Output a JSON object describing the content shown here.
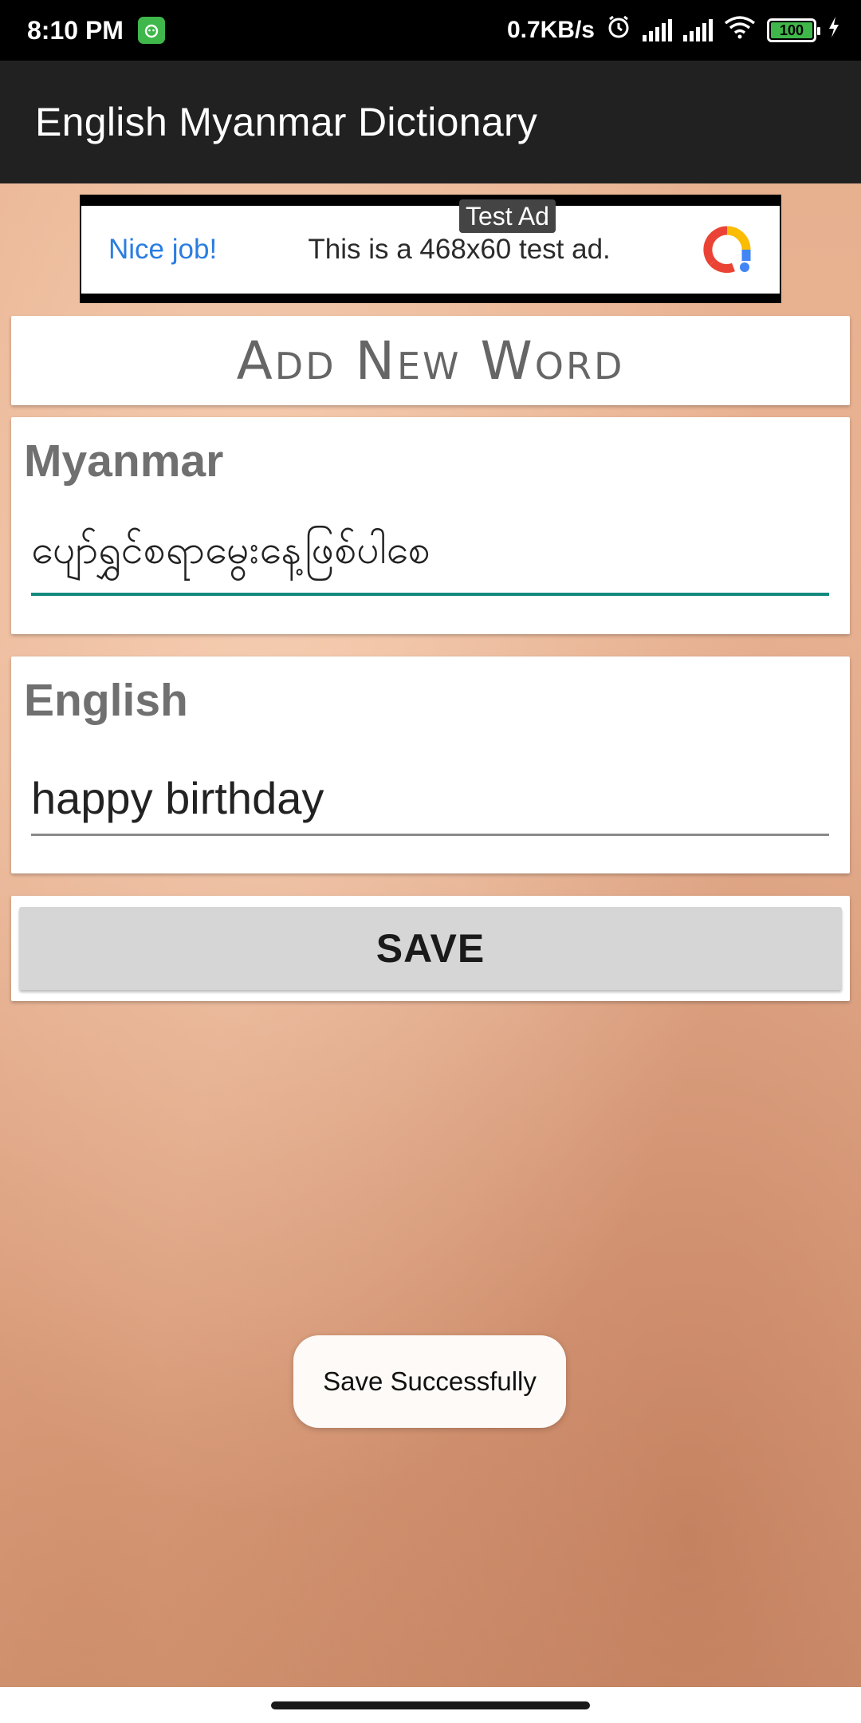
{
  "status_bar": {
    "time": "8:10 PM",
    "network_speed": "0.7KB/s",
    "battery_level": "100",
    "icons": [
      "android-notification-icon",
      "alarm-icon",
      "signal-icon",
      "signal-icon",
      "wifi-icon",
      "battery-icon",
      "charging-icon"
    ]
  },
  "app_bar": {
    "title": "English Myanmar Dictionary"
  },
  "ad": {
    "badge": "Test Ad",
    "headline": "Nice job!",
    "text": "This is a 468x60 test ad.",
    "logo_icon": "ad-logo-icon"
  },
  "form": {
    "heading": "Add New Word",
    "myanmar_label": "Myanmar",
    "myanmar_value": "ပျော်ရွှင်စရာမွေးနေ့ဖြစ်ပါစေ",
    "english_label": "English",
    "english_value": "happy birthday",
    "save_label": "SAVE"
  },
  "toast": {
    "message": "Save Successfully"
  },
  "colors": {
    "app_bar": "#212121",
    "accent": "#148a7f",
    "ad_link": "#2a7de1",
    "button": "#d6d6d6"
  }
}
